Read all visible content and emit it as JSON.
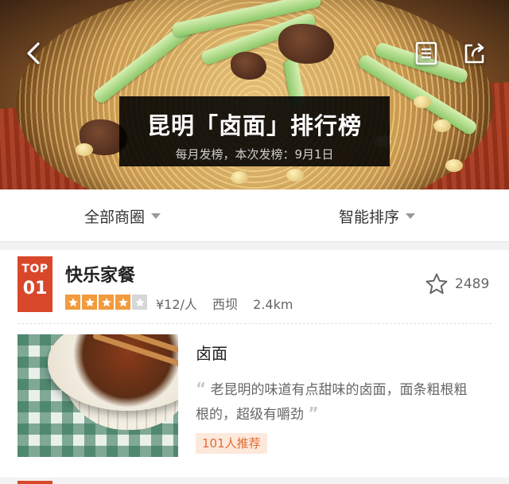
{
  "hero": {
    "title": "昆明「卤面」排行榜",
    "subtitle": "每月发榜，本次发榜：9月1日"
  },
  "nav": {
    "back_icon": "chevron-left-icon",
    "list_icon": "document-list-icon",
    "share_icon": "share-icon"
  },
  "filters": {
    "area": "全部商圈",
    "sort": "智能排序"
  },
  "entry": {
    "badge_top": "TOP",
    "badge_rank": "01",
    "name": "快乐家餐",
    "rating_stars": 4,
    "rating_max": 5,
    "price": "¥12/人",
    "district": "西坝",
    "distance": "2.4km",
    "favorites": "2489",
    "dish": "卤面",
    "quote": "老昆明的味道有点甜味的卤面，面条粗根粗根的，超级有嚼劲",
    "recommend": "101人推荐"
  },
  "colors": {
    "accent": "#d9472b",
    "star": "#f29b3d",
    "recommend_bg": "#fde8dc",
    "recommend_text": "#e36b32"
  }
}
